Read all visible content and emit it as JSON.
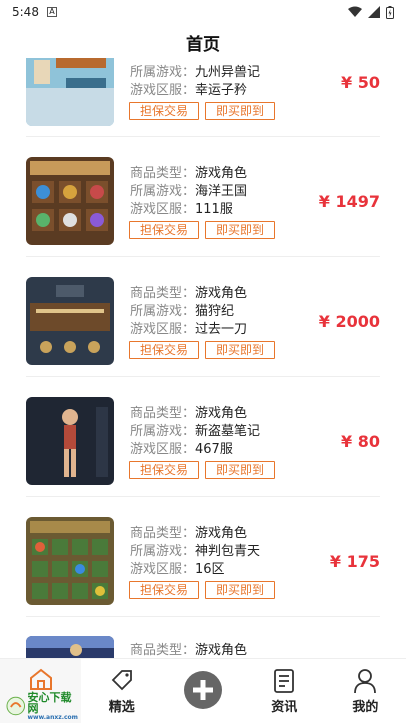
{
  "status": {
    "time": "5:48"
  },
  "header": {
    "title": "首页"
  },
  "labels": {
    "type": "商品类型：",
    "game": "所属游戏：",
    "server": "游戏区服："
  },
  "buttons": {
    "guarantee": "担保交易",
    "buy": "即买即到"
  },
  "items": [
    {
      "game": "九州异兽记",
      "server": "幸运子矜",
      "price": "¥ 50"
    },
    {
      "type": "游戏角色",
      "game": "海洋王国",
      "server": "111服",
      "price": "¥ 1497"
    },
    {
      "type": "游戏角色",
      "game": "猫狩纪",
      "server": "过去一刀",
      "price": "¥ 2000"
    },
    {
      "type": "游戏角色",
      "game": "新盗墓笔记",
      "server": "467服",
      "price": "¥ 80"
    },
    {
      "type": "游戏角色",
      "game": "神判包青天",
      "server": "16区",
      "price": "¥ 175"
    },
    {
      "type": "游戏角色"
    }
  ],
  "tabs": {
    "home": "首页",
    "featured": "精选",
    "news": "资讯",
    "mine": "我的"
  },
  "watermark": {
    "text": "安心下载网",
    "url": "www.anxz.com"
  },
  "colors": {
    "accent": "#e8762c",
    "price": "#e8333b"
  }
}
